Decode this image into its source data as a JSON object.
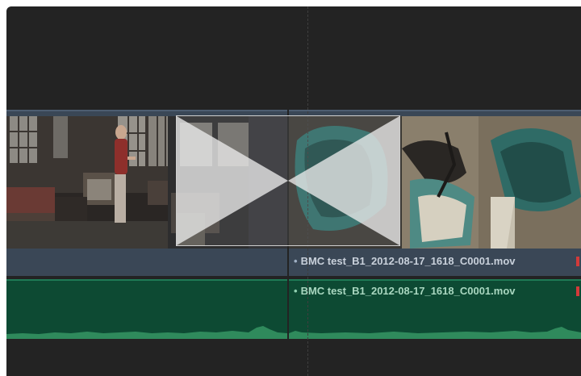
{
  "timeline": {
    "video_track": {
      "clips": [
        {
          "name": ""
        },
        {
          "name": "BMC test_B1_2012-08-17_1618_C0001.mov",
          "marker_icon": "red-flag-icon"
        }
      ]
    },
    "transition": {
      "icon": "cross-dissolve-icon"
    },
    "audio_track": {
      "clips": [
        {
          "name": ""
        },
        {
          "name": "BMC test_B1_2012-08-17_1618_C0001.mov",
          "marker_icon": "red-flag-icon"
        }
      ]
    },
    "colors": {
      "background": "#232323",
      "video_clip": "#3a4756",
      "audio_clip": "#0d4a33",
      "waveform": "#2f8a5c",
      "marker": "#d23a3a"
    }
  }
}
